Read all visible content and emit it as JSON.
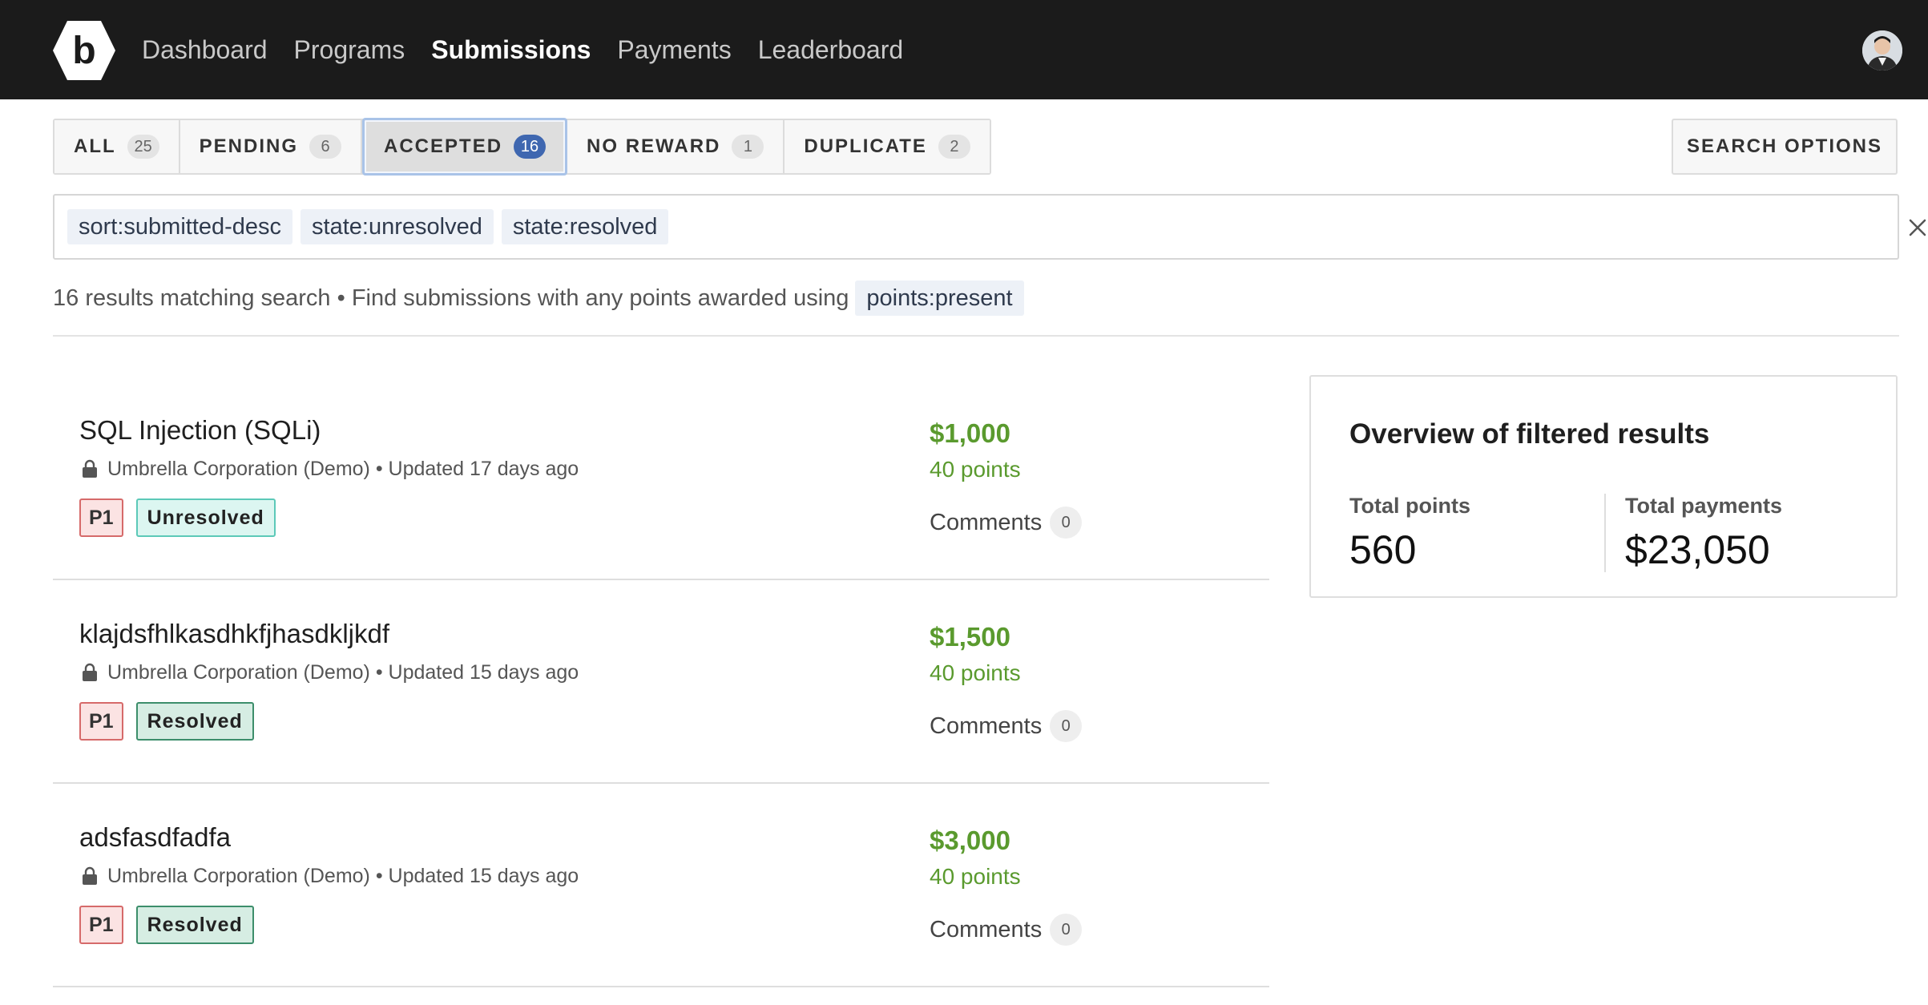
{
  "nav": {
    "links": [
      "Dashboard",
      "Programs",
      "Submissions",
      "Payments",
      "Leaderboard"
    ],
    "active": "Submissions",
    "logo_letter": "b"
  },
  "tabs": [
    {
      "label": "ALL",
      "count": "25"
    },
    {
      "label": "PENDING",
      "count": "6"
    },
    {
      "label": "ACCEPTED",
      "count": "16",
      "active": true
    },
    {
      "label": "NO REWARD",
      "count": "1"
    },
    {
      "label": "DUPLICATE",
      "count": "2"
    }
  ],
  "search_options_label": "SEARCH OPTIONS",
  "search": {
    "chips": [
      "sort:submitted-desc",
      "state:unresolved",
      "state:resolved"
    ]
  },
  "summary": {
    "text": "16 results matching search • Find submissions with any points awarded using",
    "chip": "points:present"
  },
  "submissions": [
    {
      "title": "SQL Injection (SQLi)",
      "meta": "Umbrella Corporation (Demo) • Updated 17 days ago",
      "priority": "P1",
      "status": "Unresolved",
      "amount": "$1,000",
      "points": "40 points",
      "comments_label": "Comments",
      "comments_count": "0"
    },
    {
      "title": "klajdsfhlkasdhkfjhasdkljkdf",
      "meta": "Umbrella Corporation (Demo) • Updated 15 days ago",
      "priority": "P1",
      "status": "Resolved",
      "amount": "$1,500",
      "points": "40 points",
      "comments_label": "Comments",
      "comments_count": "0"
    },
    {
      "title": "adsfasdfadfa",
      "meta": "Umbrella Corporation (Demo) • Updated 15 days ago",
      "priority": "P1",
      "status": "Resolved",
      "amount": "$3,000",
      "points": "40 points",
      "comments_label": "Comments",
      "comments_count": "0"
    }
  ],
  "overview": {
    "title": "Overview of filtered results",
    "total_points_label": "Total points",
    "total_points": "560",
    "total_payments_label": "Total payments",
    "total_payments": "$23,050"
  },
  "colors": {
    "navbar": "#1b1b1b",
    "money_green": "#5a9a2e",
    "active_count": "#3f67b0"
  }
}
